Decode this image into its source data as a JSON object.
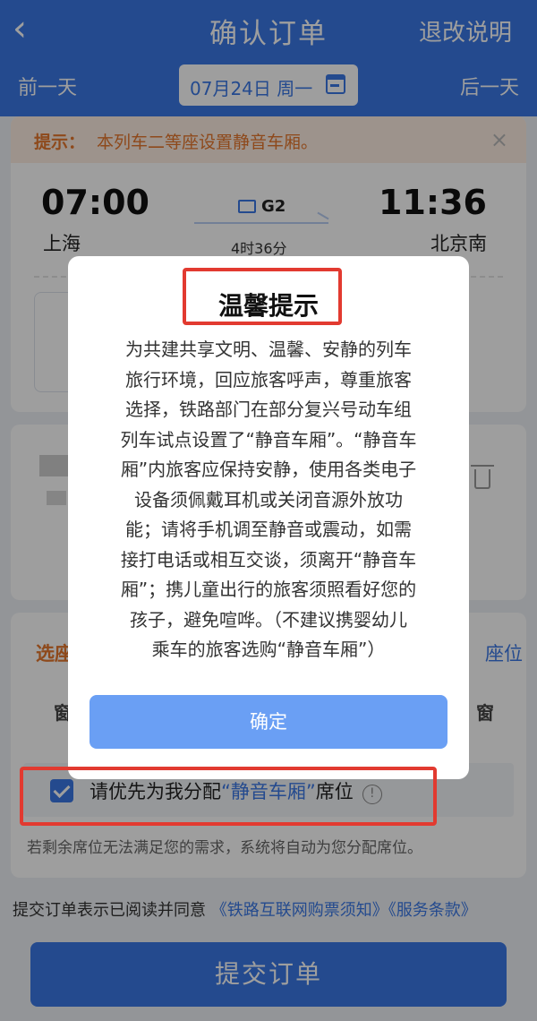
{
  "header": {
    "back_icon": "chevron-left-icon",
    "title": "确认订单",
    "refund_link": "退改说明",
    "prev_day": "前一天",
    "next_day": "后一天",
    "date": "07月24日 周一",
    "calendar_icon": "calendar-icon",
    "color": "#3a78e6"
  },
  "tip": {
    "label": "提示：",
    "text": "本列车二等座设置静音车厢。",
    "close": "×"
  },
  "trip": {
    "depart_time": "07:00",
    "depart_station": "上海",
    "arrive_time": "11:36",
    "arrive_station": "北京南",
    "train_no": "G2",
    "duration": "4时36分"
  },
  "seat_selection": {
    "title": "选座",
    "right_label": "座位",
    "window_left": "窗",
    "window_right": "窗",
    "quiet_pref_prefix": "请优先为我分配",
    "quiet_pref_link": "“静音车厢”",
    "quiet_pref_suffix": "席位",
    "quiet_pref_checked": true,
    "info_icon": "ⓘ",
    "note": "若剩余席位无法满足您的需求，系统将自动为您分配席位。"
  },
  "agreement": {
    "prefix": "提交订单表示已阅读并同意",
    "link1": "《铁路互联网购票须知》",
    "link2": "《服务条款》"
  },
  "submit_label": "提交订单",
  "dialog": {
    "title": "温馨提示",
    "lines": [
      "为共建共享文明、温馨、安静的列车",
      "旅行环境，回应旅客呼声，尊重旅客",
      "选择，铁路部门在部分复兴号动车组",
      "列车试点设置了“静音车厢”。“静音车",
      "厢”内旅客应保持安静，使用各类电子",
      "设备须佩戴耳机或关闭音源外放功",
      "能；请将手机调至静音或震动，如需",
      "接打电话或相互交谈，须离开“静音车",
      "厢”；携儿童出行的旅客须照看好您的",
      "孩子，避免喧哗。（不建议携婴幼儿",
      "乘车的旅客选购“静音车厢”）"
    ],
    "confirm": "确定"
  },
  "colors": {
    "accent": "#3a78e6",
    "warning": "#e5772c",
    "annotation": "#e23a30",
    "dialog_button": "#6a9ff4"
  }
}
